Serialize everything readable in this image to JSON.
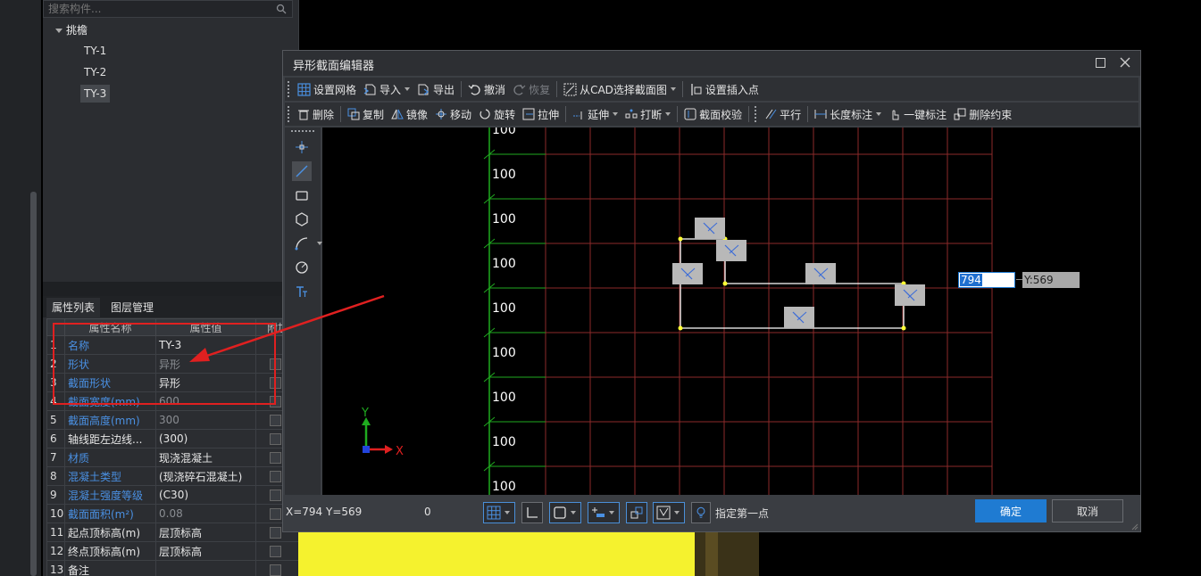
{
  "background_app": {
    "search": {
      "placeholder": "搜索构件..."
    },
    "tree": {
      "root": "挑檐",
      "items": [
        "TY-1",
        "TY-2",
        "TY-3"
      ],
      "selected": "TY-3"
    },
    "property_panel": {
      "tabs": [
        "属性列表",
        "图层管理"
      ],
      "headers": [
        "属性名称",
        "属性值",
        "附加"
      ],
      "rows": [
        {
          "num": "1",
          "name": "名称",
          "value": "TY-3",
          "blue": true,
          "dim": false,
          "check": false
        },
        {
          "num": "2",
          "name": "形状",
          "value": "异形",
          "blue": true,
          "dim": true,
          "check": true
        },
        {
          "num": "3",
          "name": "截面形状",
          "value": "异形",
          "blue": true,
          "dim": false,
          "check": true
        },
        {
          "num": "4",
          "name": "截面宽度(mm)",
          "value": "600",
          "blue": true,
          "dim": true,
          "check": true
        },
        {
          "num": "5",
          "name": "截面高度(mm)",
          "value": "300",
          "blue": true,
          "dim": true,
          "check": true
        },
        {
          "num": "6",
          "name": "轴线距左边线...",
          "value": "(300)",
          "blue": false,
          "dim": false,
          "check": true
        },
        {
          "num": "7",
          "name": "材质",
          "value": "现浇混凝土",
          "blue": true,
          "dim": false,
          "check": true
        },
        {
          "num": "8",
          "name": "混凝土类型",
          "value": "(现浇碎石混凝土)",
          "blue": true,
          "dim": false,
          "check": true
        },
        {
          "num": "9",
          "name": "混凝土强度等级",
          "value": "(C30)",
          "blue": true,
          "dim": false,
          "check": true
        },
        {
          "num": "10",
          "name": "截面面积(m²)",
          "value": "0.08",
          "blue": true,
          "dim": true,
          "check": true
        },
        {
          "num": "11",
          "name": "起点顶标高(m)",
          "value": "层顶标高",
          "blue": false,
          "dim": false,
          "check": true
        },
        {
          "num": "12",
          "name": "终点顶标高(m)",
          "value": "层顶标高",
          "blue": false,
          "dim": false,
          "check": true
        },
        {
          "num": "13",
          "name": "备注",
          "value": "",
          "blue": false,
          "dim": false,
          "check": true
        }
      ]
    }
  },
  "dialog": {
    "title": "异形截面编辑器",
    "toolbar1": {
      "set_grid": "设置网格",
      "import": "导入",
      "export": "导出",
      "undo": "撤消",
      "redo": "恢复",
      "from_cad": "从CAD选择截面图",
      "set_insert_point": "设置插入点"
    },
    "toolbar2": {
      "delete": "删除",
      "copy": "复制",
      "mirror": "镜像",
      "move": "移动",
      "rotate": "旋转",
      "stretch": "拉伸",
      "extend": "延伸",
      "break": "打断",
      "section_check": "截面校验",
      "parallel": "平行",
      "length_dim": "长度标注",
      "one_click_dim": "一键标注",
      "delete_constraint": "删除约束"
    },
    "canvas": {
      "row_labels": [
        "100",
        "100",
        "100",
        "100",
        "100",
        "100",
        "100",
        "100",
        "100"
      ],
      "x_input_value": "794",
      "y_display": "Y:569",
      "axis_x": "X",
      "axis_y": "Y"
    },
    "status": {
      "coords": "X=794 Y=569",
      "zero": "0",
      "hint": "指定第一点",
      "ok": "确定",
      "cancel": "取消"
    }
  },
  "colors": {
    "grid_line": "#8b2a2a",
    "green_axis": "#1faa1f",
    "shape_stroke": "#ffffff",
    "vertex": "#ffff33",
    "highlight_box": "#e02020",
    "primary_button": "#1f7bd2"
  }
}
